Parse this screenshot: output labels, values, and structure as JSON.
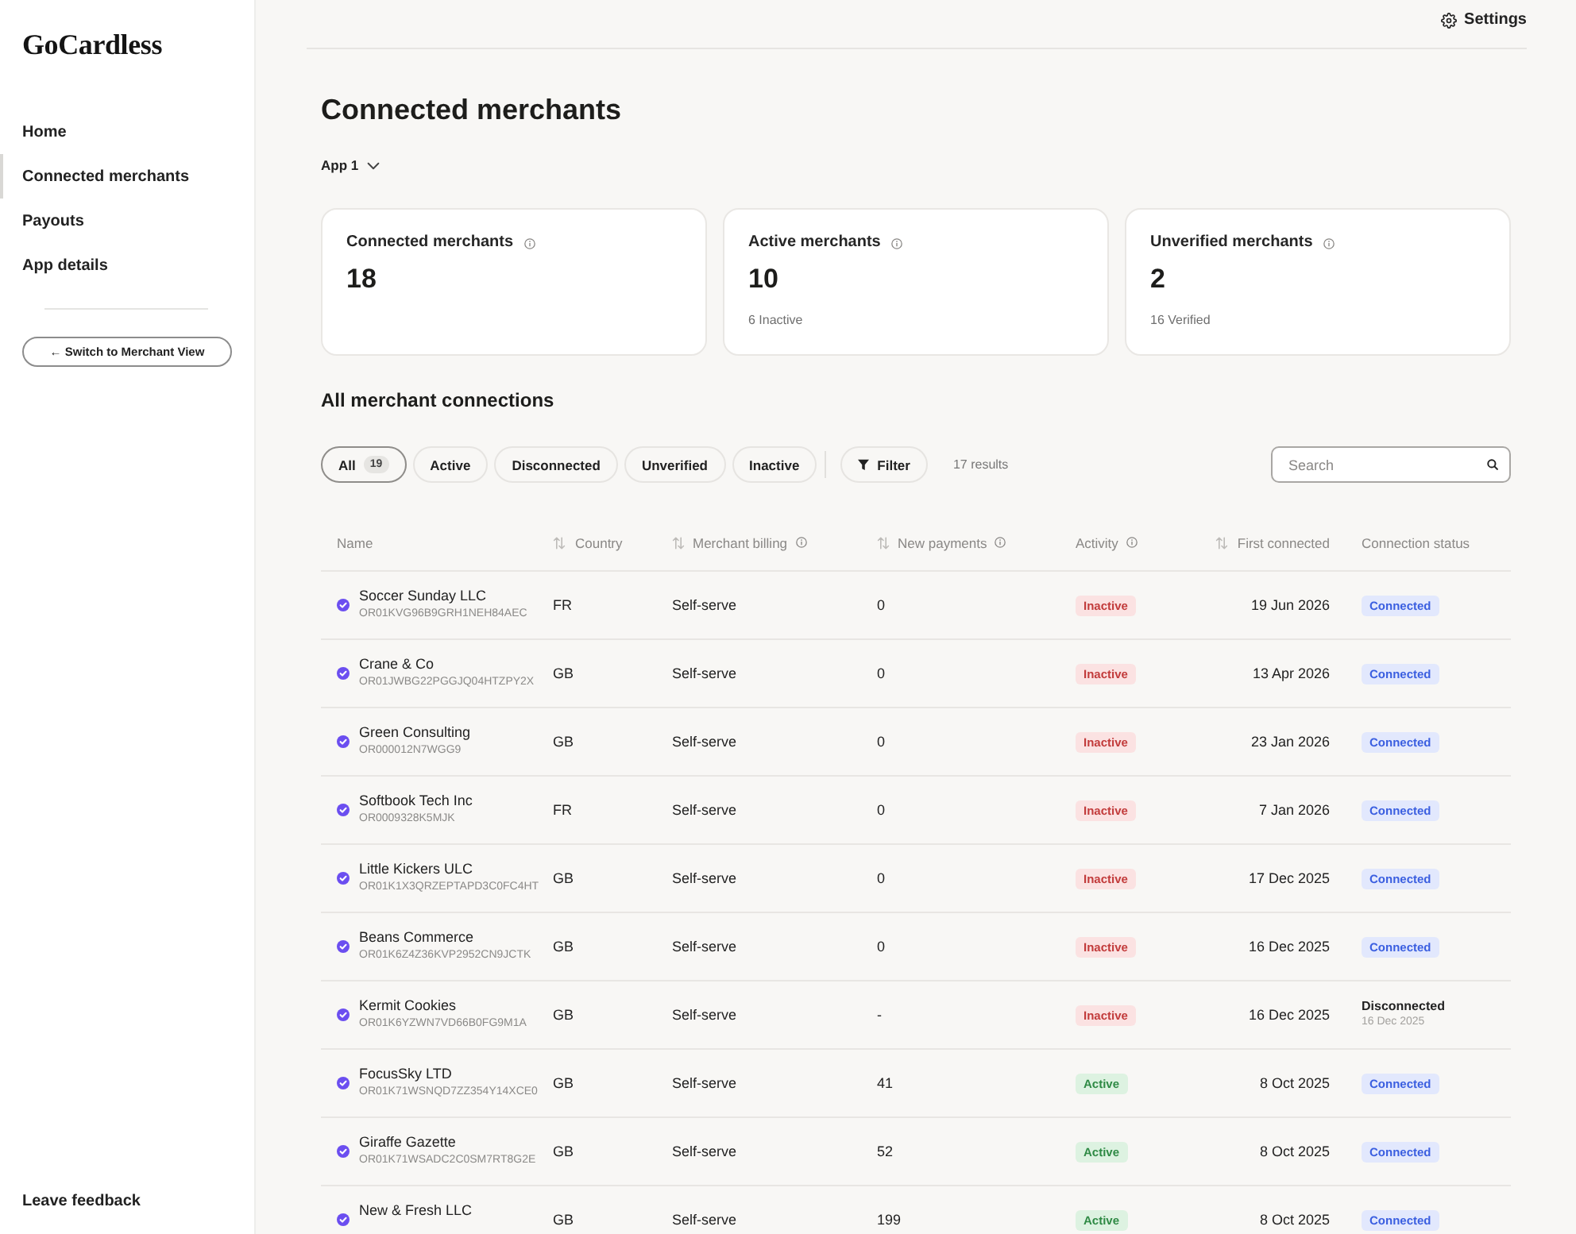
{
  "sidebar": {
    "logo": "GoCardless",
    "items": [
      {
        "label": "Home",
        "selected": false
      },
      {
        "label": "Connected merchants",
        "selected": true
      },
      {
        "label": "Payouts",
        "selected": false
      },
      {
        "label": "App details",
        "selected": false
      }
    ],
    "switch_button": "← Switch to Merchant View",
    "feedback_link": "Leave feedback"
  },
  "top_bar": {
    "settings": "Settings"
  },
  "page": {
    "title": "Connected merchants",
    "app_selector": "App 1"
  },
  "stat_cards": [
    {
      "label": "Connected merchants",
      "value": "18"
    },
    {
      "label": "Active merchants",
      "value": "10",
      "note": "6 Inactive"
    },
    {
      "label": "Unverified merchants",
      "value": "2",
      "note": "16 Verified"
    }
  ],
  "connections": {
    "title": "All merchant connections",
    "filters": [
      {
        "label": "All",
        "count": "19",
        "selected": true
      },
      {
        "label": "Active",
        "selected": false
      },
      {
        "label": "Disconnected",
        "selected": false
      },
      {
        "label": "Unverified",
        "selected": false
      },
      {
        "label": "Inactive",
        "selected": false
      }
    ],
    "filter_button": "Filter",
    "results": "17 results",
    "search": {
      "placeholder": "Search"
    }
  },
  "table": {
    "columns": [
      {
        "label": "Name",
        "sortable": false,
        "info": false
      },
      {
        "label": "Country",
        "sortable": true,
        "info": false
      },
      {
        "label": "Merchant billing",
        "sortable": true,
        "info": true
      },
      {
        "label": "New payments",
        "sortable": true,
        "info": true
      },
      {
        "label": "Activity",
        "sortable": false,
        "info": true
      },
      {
        "label": "First connected",
        "sortable": true,
        "info": false
      },
      {
        "label": "Connection status",
        "sortable": false,
        "info": false
      }
    ],
    "rows": [
      {
        "verified": true,
        "name": "Soccer Sunday LLC",
        "id": "OR01KVG96B9GRH1NEH84AEC",
        "country": "FR",
        "billing": "Self-serve",
        "new_payments": "0",
        "activity": {
          "kind": "inactive",
          "label": "Inactive"
        },
        "first_connected": "19 Jun 2026",
        "status": {
          "kind": "connected",
          "label": "Connected"
        }
      },
      {
        "verified": true,
        "name": "Crane & Co",
        "id": "OR01JWBG22PGGJQ04HTZPY2X",
        "country": "GB",
        "billing": "Self-serve",
        "new_payments": "0",
        "activity": {
          "kind": "inactive",
          "label": "Inactive"
        },
        "first_connected": "13 Apr 2026",
        "status": {
          "kind": "connected",
          "label": "Connected"
        }
      },
      {
        "verified": true,
        "name": "Green Consulting",
        "id": "OR000012N7WGG9",
        "country": "GB",
        "billing": "Self-serve",
        "new_payments": "0",
        "activity": {
          "kind": "inactive",
          "label": "Inactive"
        },
        "first_connected": "23 Jan 2026",
        "status": {
          "kind": "connected",
          "label": "Connected"
        }
      },
      {
        "verified": true,
        "name": "Softbook Tech Inc",
        "id": "OR0009328K5MJK",
        "country": "FR",
        "billing": "Self-serve",
        "new_payments": "0",
        "activity": {
          "kind": "inactive",
          "label": "Inactive"
        },
        "first_connected": "7 Jan 2026",
        "status": {
          "kind": "connected",
          "label": "Connected"
        }
      },
      {
        "verified": true,
        "name": "Little Kickers ULC",
        "id": "OR01K1X3QRZEPTAPD3C0FC4HT",
        "country": "GB",
        "billing": "Self-serve",
        "new_payments": "0",
        "activity": {
          "kind": "inactive",
          "label": "Inactive"
        },
        "first_connected": "17 Dec 2025",
        "status": {
          "kind": "connected",
          "label": "Connected"
        }
      },
      {
        "verified": true,
        "name": "Beans Commerce",
        "id": "OR01K6Z4Z36KVP2952CN9JCTK",
        "country": "GB",
        "billing": "Self-serve",
        "new_payments": "0",
        "activity": {
          "kind": "inactive",
          "label": "Inactive"
        },
        "first_connected": "16 Dec 2025",
        "status": {
          "kind": "connected",
          "label": "Connected"
        }
      },
      {
        "verified": true,
        "name": "Kermit Cookies",
        "id": "OR01K6YZWN7VD66B0FG9M1A",
        "country": "GB",
        "billing": "Self-serve",
        "new_payments": "-",
        "activity": {
          "kind": "inactive",
          "label": "Inactive"
        },
        "first_connected": "16 Dec 2025",
        "status": {
          "kind": "disconnected",
          "label": "Disconnected",
          "date": "16 Dec 2025"
        }
      },
      {
        "verified": true,
        "name": "FocusSky LTD",
        "id": "OR01K71WSNQD7ZZ354Y14XCE0",
        "country": "GB",
        "billing": "Self-serve",
        "new_payments": "41",
        "activity": {
          "kind": "active",
          "label": "Active"
        },
        "first_connected": "8 Oct 2025",
        "status": {
          "kind": "connected",
          "label": "Connected"
        }
      },
      {
        "verified": true,
        "name": "Giraffe Gazette",
        "id": "OR01K71WSADC2C0SM7RT8G2E",
        "country": "GB",
        "billing": "Self-serve",
        "new_payments": "52",
        "activity": {
          "kind": "active",
          "label": "Active"
        },
        "first_connected": "8 Oct 2025",
        "status": {
          "kind": "connected",
          "label": "Connected"
        }
      },
      {
        "verified": true,
        "name": "New & Fresh LLC",
        "country": "GB",
        "billing": "Self-serve",
        "new_payments": "199",
        "activity": {
          "kind": "active",
          "label": "Active"
        },
        "first_connected": "8 Oct 2025",
        "status": {
          "kind": "connected",
          "label": "Connected"
        }
      }
    ]
  }
}
